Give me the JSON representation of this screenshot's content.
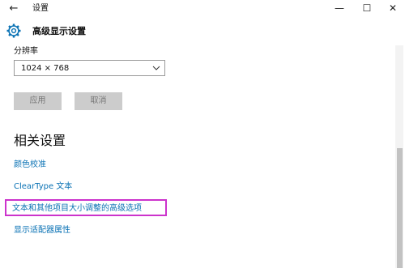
{
  "window": {
    "back_icon": "←",
    "title": "设置",
    "minimize_icon": "—",
    "maximize_icon": "☐",
    "close_icon": "✕"
  },
  "header": {
    "icon": "gear-icon",
    "title": "高级显示设置"
  },
  "resolution": {
    "label": "分辨率",
    "value": "1024 × 768"
  },
  "buttons": {
    "apply": "应用",
    "cancel": "取消"
  },
  "related": {
    "title": "相关设置",
    "links": [
      "颜色校准",
      "ClearType 文本",
      "文本和其他项目大小调整的高级选项",
      "显示适配器属性"
    ]
  },
  "colors": {
    "link": "#0a72b4",
    "highlight": "#cc33cc",
    "button_bg": "#cccccc"
  }
}
